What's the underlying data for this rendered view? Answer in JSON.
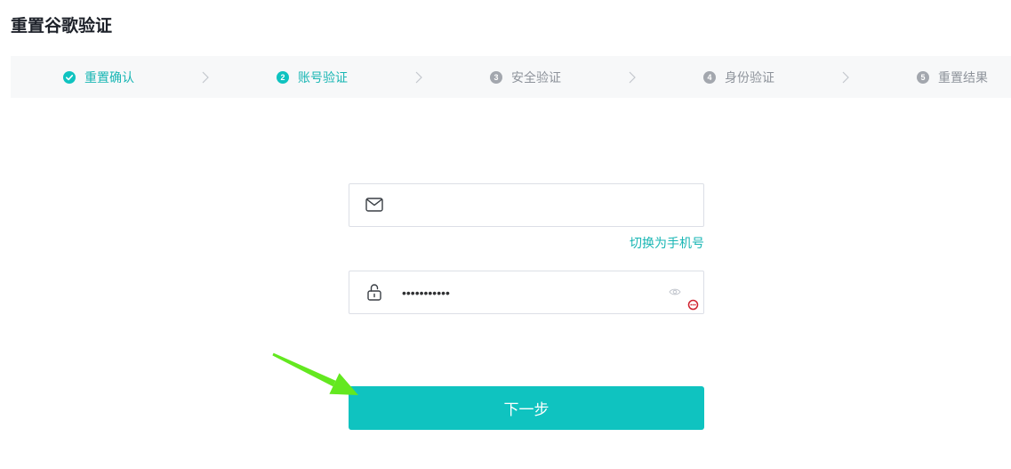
{
  "page": {
    "title": "重置谷歌验证"
  },
  "steps": {
    "current_step": 2,
    "separator_icon": "chevron-right-icon",
    "items": [
      {
        "label": "重置确认",
        "icon": "check-circle-icon"
      },
      {
        "number": "2",
        "label": "账号验证"
      },
      {
        "number": "3",
        "label": "安全验证"
      },
      {
        "number": "4",
        "label": "身份验证"
      },
      {
        "number": "5",
        "label": "重置结果"
      }
    ]
  },
  "form": {
    "email": {
      "icon": "mail-icon",
      "value": ""
    },
    "switch_link": "切换为手机号",
    "password": {
      "icon": "lock-icon",
      "value": "•••••••••••",
      "toggle_icon": "eye-icon",
      "extension_icon": "password-manager-icon"
    },
    "submit_label": "下一步"
  },
  "colors": {
    "accent": "#0fc3c0",
    "accent_text": "#19b6b4",
    "pending": "#a3a7ae",
    "pending_text": "#8e939b",
    "steps_bg": "#f7f8f9",
    "title": "#1d2129",
    "annotation": "#63e81f",
    "alert": "#d0212f",
    "border": "#dcdfe6",
    "icon": "#3a3f45",
    "icon_light": "#c0c4cc",
    "chevron": "#c3c7cd"
  }
}
